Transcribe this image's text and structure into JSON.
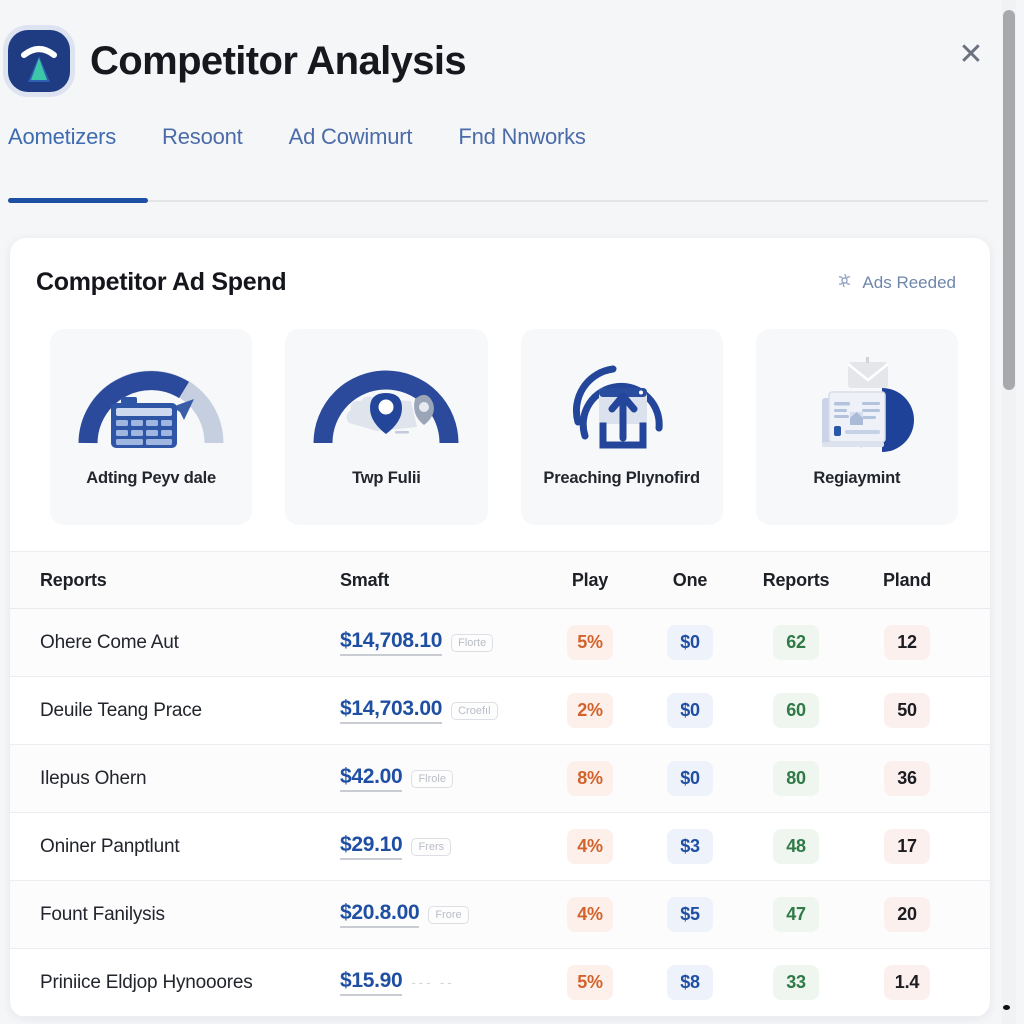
{
  "header": {
    "title": "Competitor Analysis",
    "logo_icon": "wifi-tree-logo-icon",
    "close_icon": "close-icon",
    "close_label": "✕"
  },
  "tabs": [
    {
      "label": "Aometizers",
      "active": true
    },
    {
      "label": "Resoont",
      "active": false
    },
    {
      "label": "Ad Cowimurt",
      "active": false
    },
    {
      "label": "Fnd Nnworks",
      "active": false
    }
  ],
  "card": {
    "title": "Competitor Ad Spend",
    "action_label": "Ads Reeded",
    "action_icon": "gear-icon"
  },
  "tiles": [
    {
      "label": "Adting Peyv dale",
      "art": "gauge-calculator-icon",
      "gauge_fill_pct": 70
    },
    {
      "label": "Twp Fulii",
      "art": "gauge-map-pin-icon",
      "gauge_fill_pct": 100
    },
    {
      "label": "Preaching Plıynofird",
      "art": "upload-circle-icon",
      "gauge_fill_pct": 85
    },
    {
      "label": "Regiaymint",
      "art": "mail-document-pie-icon",
      "gauge_fill_pct": 0
    }
  ],
  "table": {
    "columns": [
      "Reports",
      "Smaft",
      "Play",
      "One",
      "Reports",
      "Pland"
    ],
    "rows": [
      {
        "name": "Ohere Come Aut",
        "spend": "$14,708.10",
        "spend_tag": "Florte",
        "play": "5%",
        "one": "$0",
        "reports": "62",
        "pland": "12"
      },
      {
        "name": "Deuile Teang Prace",
        "spend": "$14,703.00",
        "spend_tag": "Croefıl",
        "play": "2%",
        "one": "$0",
        "reports": "60",
        "pland": "50"
      },
      {
        "name": "Ilepus Ohern",
        "spend": "$42.00",
        "spend_tag": "Flrole",
        "play": "8%",
        "one": "$0",
        "reports": "80",
        "pland": "36"
      },
      {
        "name": "Oniner Panptlunt",
        "spend": "$29.10",
        "spend_tag": "Frers",
        "play": "4%",
        "one": "$3",
        "reports": "48",
        "pland": "17"
      },
      {
        "name": "Fount Fanilysis",
        "spend": "$20.8.00",
        "spend_tag": "Frore",
        "play": "4%",
        "one": "$5",
        "reports": "47",
        "pland": "20"
      },
      {
        "name": "Priniice Eldjop Hynooores",
        "spend": "$15.90",
        "spend_tag": "",
        "play": "5%",
        "one": "$8",
        "reports": "33",
        "pland": "1.4"
      }
    ]
  },
  "colors": {
    "accent_blue": "#1f4fa3",
    "tab_blue": "#4b6ca8",
    "pill_orange": "#d2632c",
    "pill_green": "#2f7a46",
    "gauge_dark": "#2b4a9b",
    "gauge_light": "#c5cfe0"
  }
}
